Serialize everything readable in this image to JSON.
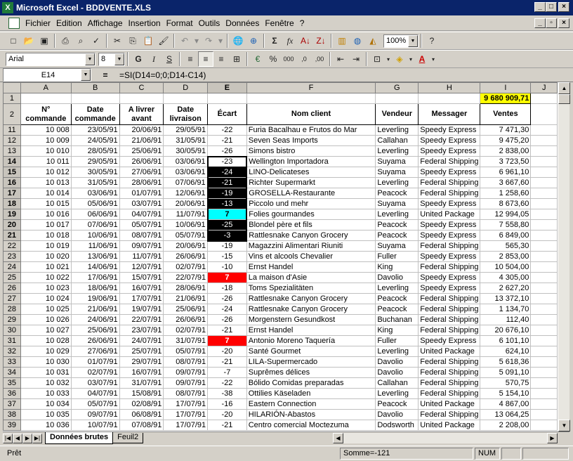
{
  "window": {
    "title": "Microsoft Excel - BDDVENTE.XLS"
  },
  "menu": [
    "Fichier",
    "Edition",
    "Affichage",
    "Insertion",
    "Format",
    "Outils",
    "Données",
    "Fenêtre",
    "?"
  ],
  "toolbar": {
    "zoom": "100%",
    "font": "Arial",
    "size": "8"
  },
  "formula_bar": {
    "name_box": "E14",
    "equals": "=",
    "formula": "=SI(D14=0;0;D14-C14)"
  },
  "columns": [
    "A",
    "B",
    "C",
    "D",
    "E",
    "F",
    "G",
    "H",
    "I",
    "J"
  ],
  "total": "9 680 909,71",
  "headers": [
    "N° commande",
    "Date commande",
    "A livrer avant",
    "Date livraison",
    "Écart",
    "Nom client",
    "Vendeur",
    "Messager",
    "Ventes"
  ],
  "rows": [
    [
      "11",
      "10 008",
      "23/05/91",
      "20/06/91",
      "29/05/91",
      "-22",
      "Furia Bacalhau e Frutos do Mar",
      "Leverling",
      "Speedy Express",
      "7 471,30"
    ],
    [
      "12",
      "10 009",
      "24/05/91",
      "21/06/91",
      "31/05/91",
      "-21",
      "Seven Seas Imports",
      "Callahan",
      "Speedy Express",
      "9 475,20"
    ],
    [
      "13",
      "10 010",
      "28/05/91",
      "25/06/91",
      "30/05/91",
      "-26",
      "Simons bistro",
      "Leverling",
      "Speedy Express",
      "2 838,00"
    ],
    [
      "14",
      "10 011",
      "29/05/91",
      "26/06/91",
      "03/06/91",
      "-23",
      "Wellington Importadora",
      "Suyama",
      "Federal Shipping",
      "3 723,50"
    ],
    [
      "15",
      "10 012",
      "30/05/91",
      "27/06/91",
      "03/06/91",
      "-24",
      "LINO-Delicateses",
      "Suyama",
      "Speedy Express",
      "6 961,10"
    ],
    [
      "16",
      "10 013",
      "31/05/91",
      "28/06/91",
      "07/06/91",
      "-21",
      "Richter Supermarkt",
      "Leverling",
      "Federal Shipping",
      "3 667,60"
    ],
    [
      "17",
      "10 014",
      "03/06/91",
      "01/07/91",
      "12/06/91",
      "-19",
      "GROSELLA-Restaurante",
      "Peacock",
      "Federal Shipping",
      "1 258,60"
    ],
    [
      "18",
      "10 015",
      "05/06/91",
      "03/07/91",
      "20/06/91",
      "-13",
      "Piccolo und mehr",
      "Suyama",
      "Speedy Express",
      "8 673,60"
    ],
    [
      "19",
      "10 016",
      "06/06/91",
      "04/07/91",
      "11/07/91",
      "7",
      "Folies gourmandes",
      "Leverling",
      "United Package",
      "12 994,05"
    ],
    [
      "20",
      "10 017",
      "07/06/91",
      "05/07/91",
      "10/06/91",
      "-25",
      "Blondel père et fils",
      "Peacock",
      "Speedy Express",
      "7 558,80"
    ],
    [
      "21",
      "10 018",
      "10/06/91",
      "08/07/91",
      "05/07/91",
      "-3",
      "Rattlesnake Canyon Grocery",
      "Peacock",
      "Speedy Express",
      "6 849,00"
    ],
    [
      "22",
      "10 019",
      "11/06/91",
      "09/07/91",
      "20/06/91",
      "-19",
      "Magazzini Alimentari Riuniti",
      "Suyama",
      "Federal Shipping",
      "565,30"
    ],
    [
      "23",
      "10 020",
      "13/06/91",
      "11/07/91",
      "26/06/91",
      "-15",
      "Vins et alcools Chevalier",
      "Fuller",
      "Speedy Express",
      "2 853,00"
    ],
    [
      "24",
      "10 021",
      "14/06/91",
      "12/07/91",
      "02/07/91",
      "-10",
      "Ernst Handel",
      "King",
      "Federal Shipping",
      "10 504,00"
    ],
    [
      "25",
      "10 022",
      "17/06/91",
      "15/07/91",
      "22/07/91",
      "7",
      "La maison d'Asie",
      "Davolio",
      "Speedy Express",
      "4 305,00"
    ],
    [
      "26",
      "10 023",
      "18/06/91",
      "16/07/91",
      "28/06/91",
      "-18",
      "Toms Spezialitäten",
      "Leverling",
      "Speedy Express",
      "2 627,20"
    ],
    [
      "27",
      "10 024",
      "19/06/91",
      "17/07/91",
      "21/06/91",
      "-26",
      "Rattlesnake Canyon Grocery",
      "Peacock",
      "Federal Shipping",
      "13 372,10"
    ],
    [
      "28",
      "10 025",
      "21/06/91",
      "19/07/91",
      "25/06/91",
      "-24",
      "Rattlesnake Canyon Grocery",
      "Peacock",
      "Federal Shipping",
      "1 134,70"
    ],
    [
      "29",
      "10 026",
      "24/06/91",
      "22/07/91",
      "26/06/91",
      "-26",
      "Morgenstern Gesundkost",
      "Buchanan",
      "Federal Shipping",
      "112,40"
    ],
    [
      "30",
      "10 027",
      "25/06/91",
      "23/07/91",
      "02/07/91",
      "-21",
      "Ernst Handel",
      "King",
      "Federal Shipping",
      "20 676,10"
    ],
    [
      "31",
      "10 028",
      "26/06/91",
      "24/07/91",
      "31/07/91",
      "7",
      "Antonio Moreno Taquería",
      "Fuller",
      "Speedy Express",
      "6 101,10"
    ],
    [
      "32",
      "10 029",
      "27/06/91",
      "25/07/91",
      "05/07/91",
      "-20",
      "Santé Gourmet",
      "Leverling",
      "United Package",
      "624,10"
    ],
    [
      "33",
      "10 030",
      "01/07/91",
      "29/07/91",
      "08/07/91",
      "-21",
      "LILA-Supermercado",
      "Davolio",
      "Federal Shipping",
      "5 618,36"
    ],
    [
      "34",
      "10 031",
      "02/07/91",
      "16/07/91",
      "09/07/91",
      "-7",
      "Suprêmes délices",
      "Davolio",
      "Federal Shipping",
      "5 091,10"
    ],
    [
      "35",
      "10 032",
      "03/07/91",
      "31/07/91",
      "09/07/91",
      "-22",
      "Bólido Comidas preparadas",
      "Callahan",
      "Federal Shipping",
      "570,75"
    ],
    [
      "36",
      "10 033",
      "04/07/91",
      "15/08/91",
      "08/07/91",
      "-38",
      "Ottilies Käseladen",
      "Leverling",
      "Federal Shipping",
      "5 154,10"
    ],
    [
      "37",
      "10 034",
      "05/07/91",
      "02/08/91",
      "17/07/91",
      "-16",
      "Eastern Connection",
      "Peacock",
      "United Package",
      "4 867,00"
    ],
    [
      "38",
      "10 035",
      "09/07/91",
      "06/08/91",
      "17/07/91",
      "-20",
      "HILARIÓN-Abastos",
      "Davolio",
      "Federal Shipping",
      "13 064,25"
    ],
    [
      "39",
      "10 036",
      "10/07/91",
      "07/08/91",
      "17/07/91",
      "-21",
      "Centro comercial Moctezuma",
      "Dodsworth",
      "United Package",
      "2 208,00"
    ]
  ],
  "tabs": [
    "Données brutes",
    "Feuil2"
  ],
  "status": {
    "ready": "Prêt",
    "sum": "Somme=-121",
    "num": "NUM"
  }
}
